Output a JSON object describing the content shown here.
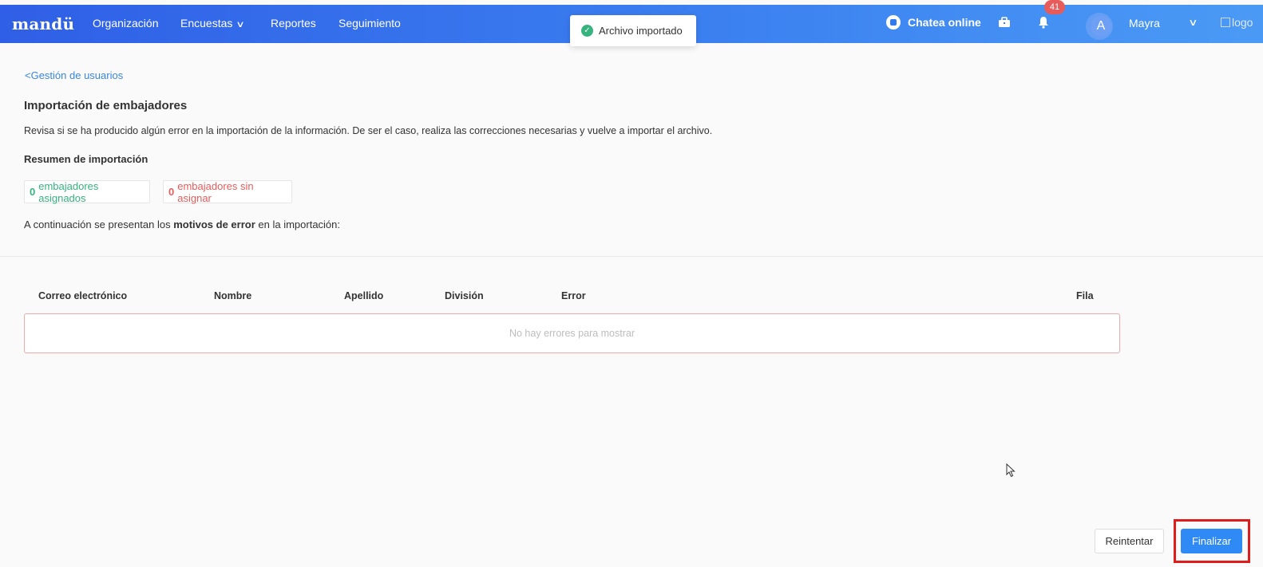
{
  "nav": {
    "logo": "mandü",
    "items": [
      {
        "label": "Organización"
      },
      {
        "label": "Encuestas"
      },
      {
        "label": "Reportes"
      },
      {
        "label": "Seguimiento"
      }
    ],
    "chat_label": "Chatea online",
    "notification_count": "41",
    "avatar_initial": "A",
    "user_name": "Mayra",
    "logo_alt": "logo"
  },
  "toast": {
    "message": "Archivo importado"
  },
  "page": {
    "back_link": "Gestión de usuarios",
    "title": "Importación de embajadores",
    "description": "Revisa si se ha producido algún error en la importación de la información. De ser el caso, realiza las correcciones necesarias y vuelve a importar el archivo.",
    "summary_title": "Resumen de importación",
    "assigned_count": "0",
    "assigned_label": "embajadores asignados",
    "unassigned_count": "0",
    "unassigned_label": "embajadores sin asignar",
    "intro_before": "A continuación se presentan los ",
    "intro_bold": "motivos de error",
    "intro_after": " en la importación:"
  },
  "table": {
    "headers": [
      "Correo electrónico",
      "Nombre",
      "Apellido",
      "División",
      "Error",
      "Fila"
    ],
    "empty_message": "No hay errores para mostrar"
  },
  "actions": {
    "retry_label": "Reintentar",
    "finish_label": "Finalizar"
  },
  "icons": {
    "toast": "check-circle-icon",
    "chat": "chat-bubble-icon",
    "briefcase": "briefcase-icon",
    "bell": "bell-icon"
  },
  "colors": {
    "accent": "#2f8af5",
    "success": "#36b37e",
    "error": "#e85b5b",
    "highlight": "#e01b1b"
  }
}
